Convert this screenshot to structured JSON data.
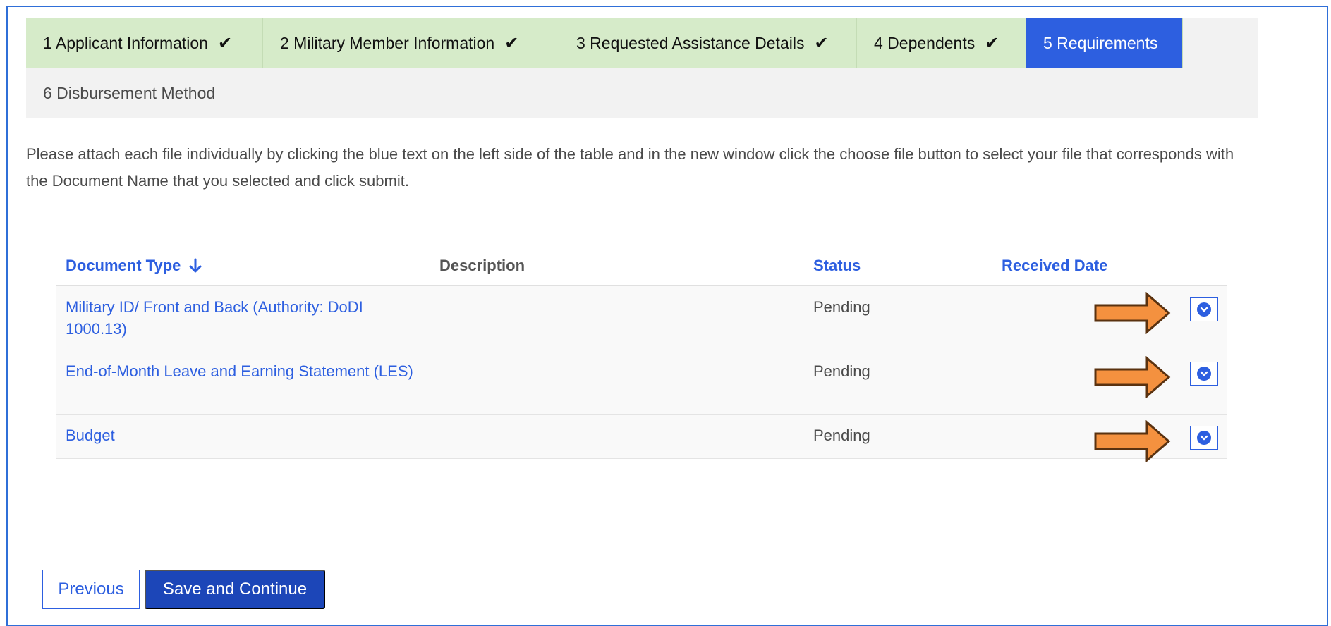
{
  "wizard": {
    "steps": [
      {
        "label": "1 Applicant Information",
        "state": "complete"
      },
      {
        "label": "2 Military Member Information",
        "state": "complete"
      },
      {
        "label": "3 Requested Assistance Details",
        "state": "complete"
      },
      {
        "label": "4 Dependents",
        "state": "complete"
      },
      {
        "label": "5 Requirements",
        "state": "active"
      },
      {
        "label": "6 Disbursement Method",
        "state": "pending"
      }
    ],
    "check_icon": "checkmark-icon"
  },
  "intro_text": "Please attach each file individually by clicking the blue text on the left side of the table and in the new window click the choose file button to select your file that corresponds with the Document Name that you selected and click submit.",
  "table": {
    "headers": {
      "document_type": "Document Type",
      "description": "Description",
      "status": "Status",
      "received_date": "Received Date"
    },
    "sort_icon": "arrow-down-icon",
    "rows": [
      {
        "document_type": "Military ID/ Front and Back (Authority: DoDI 1000.13)",
        "description": "",
        "status": "Pending",
        "received_date": ""
      },
      {
        "document_type": "End-of-Month Leave and Earning Statement (LES)",
        "description": "",
        "status": "Pending",
        "received_date": ""
      },
      {
        "document_type": "Budget",
        "description": "",
        "status": "Pending",
        "received_date": ""
      }
    ],
    "row_menu_icon": "chevron-down-circle-icon",
    "annotation_icon": "orange-arrow-icon"
  },
  "buttons": {
    "previous": "Previous",
    "save_continue": "Save and Continue"
  },
  "colors": {
    "accent": "#2d5fe0",
    "complete_step": "#d6ebc9",
    "primary_button": "#1c46b8",
    "annotation_arrow": "#f4913f"
  }
}
